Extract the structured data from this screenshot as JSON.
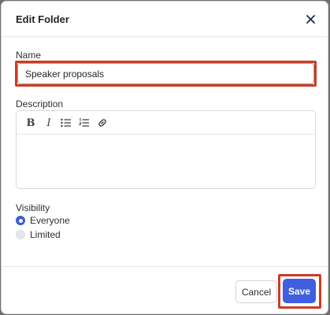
{
  "dialog": {
    "title": "Edit Folder",
    "close_icon": "close-icon"
  },
  "name_field": {
    "label": "Name",
    "value": "Speaker proposals"
  },
  "description_field": {
    "label": "Description",
    "value": "",
    "toolbar": [
      "bold-icon",
      "italic-icon",
      "bulleted-list-icon",
      "numbered-list-icon",
      "link-icon"
    ],
    "toolbar_text": {
      "bold": "B",
      "italic": "I"
    }
  },
  "visibility": {
    "label": "Visibility",
    "options": [
      {
        "label": "Everyone",
        "selected": true
      },
      {
        "label": "Limited",
        "selected": false
      }
    ]
  },
  "footer": {
    "cancel_label": "Cancel",
    "save_label": "Save"
  },
  "colors": {
    "primary": "#3f5fe0",
    "highlight": "#cf3b22"
  }
}
